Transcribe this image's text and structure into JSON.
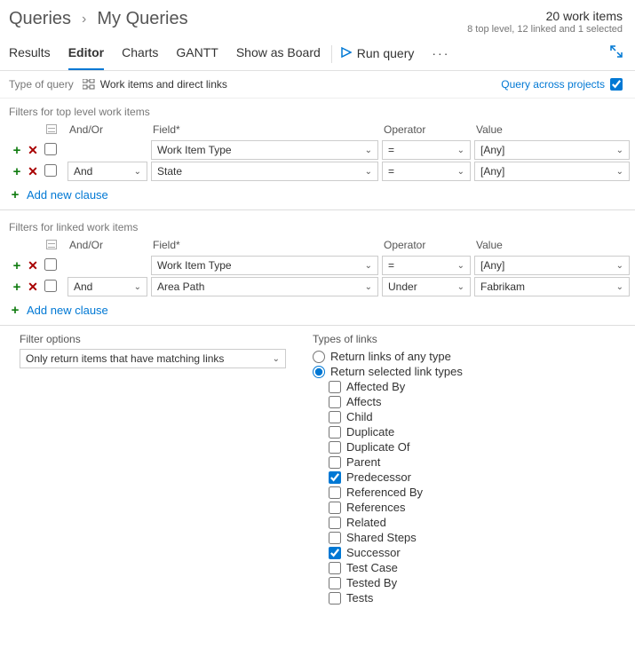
{
  "breadcrumb": {
    "root": "Queries",
    "current": "My Queries"
  },
  "summary": {
    "count": "20 work items",
    "detail": "8 top level, 12 linked and 1 selected"
  },
  "tabs": [
    "Results",
    "Editor",
    "Charts",
    "GANTT",
    "Show as Board"
  ],
  "tabs_active_index": 1,
  "run_query_label": "Run query",
  "query_type_label": "Type of query",
  "query_type_value": "Work items and direct links",
  "query_across_label": "Query across projects",
  "query_across_checked": true,
  "filters_top_label": "Filters for top level work items",
  "filters_linked_label": "Filters for linked work items",
  "columns": {
    "andor": "And/Or",
    "field": "Field*",
    "operator": "Operator",
    "value": "Value"
  },
  "top_rows": [
    {
      "checked": false,
      "andor": "",
      "field": "Work Item Type",
      "operator": "=",
      "value": "[Any]"
    },
    {
      "checked": false,
      "andor": "And",
      "field": "State",
      "operator": "=",
      "value": "[Any]"
    }
  ],
  "linked_rows": [
    {
      "checked": false,
      "andor": "",
      "field": "Work Item Type",
      "operator": "=",
      "value": "[Any]"
    },
    {
      "checked": false,
      "andor": "And",
      "field": "Area Path",
      "operator": "Under",
      "value": "Fabrikam"
    }
  ],
  "add_clause_label": "Add new clause",
  "filter_options_label": "Filter options",
  "filter_options_value": "Only return items that have matching links",
  "types_of_links_label": "Types of links",
  "link_radio": {
    "any": "Return links of any type",
    "selected": "Return selected link types",
    "choice": "selected"
  },
  "link_types": [
    {
      "label": "Affected By",
      "checked": false
    },
    {
      "label": "Affects",
      "checked": false
    },
    {
      "label": "Child",
      "checked": false
    },
    {
      "label": "Duplicate",
      "checked": false
    },
    {
      "label": "Duplicate Of",
      "checked": false
    },
    {
      "label": "Parent",
      "checked": false
    },
    {
      "label": "Predecessor",
      "checked": true
    },
    {
      "label": "Referenced By",
      "checked": false
    },
    {
      "label": "References",
      "checked": false
    },
    {
      "label": "Related",
      "checked": false
    },
    {
      "label": "Shared Steps",
      "checked": false
    },
    {
      "label": "Successor",
      "checked": true
    },
    {
      "label": "Test Case",
      "checked": false
    },
    {
      "label": "Tested By",
      "checked": false
    },
    {
      "label": "Tests",
      "checked": false
    }
  ]
}
